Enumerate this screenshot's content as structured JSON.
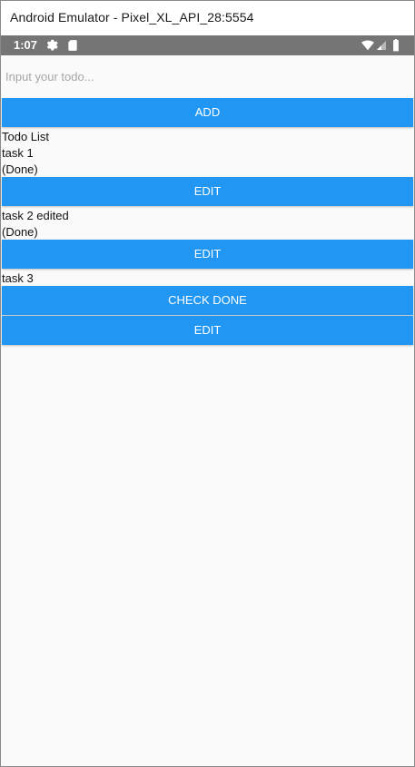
{
  "window": {
    "title": "Android Emulator - Pixel_XL_API_28:5554"
  },
  "status_bar": {
    "time": "1:07",
    "icons": [
      "settings-icon",
      "sd-card-icon",
      "wifi-icon",
      "cell-signal-icon",
      "battery-icon"
    ]
  },
  "input": {
    "placeholder": "Input your todo...",
    "value": ""
  },
  "add_button": {
    "label": "ADD"
  },
  "list": {
    "heading": "Todo List",
    "items": [
      {
        "text": "task 1",
        "status": "(Done)",
        "buttons": [
          "EDIT"
        ]
      },
      {
        "text": "task 2 edited",
        "status": "(Done)",
        "buttons": [
          "EDIT"
        ]
      },
      {
        "text": "task 3",
        "status": "",
        "buttons": [
          "CHECK DONE",
          "EDIT"
        ]
      }
    ]
  },
  "colors": {
    "accent": "#2196f3",
    "status_bar": "#757575",
    "background": "#fafafa"
  }
}
